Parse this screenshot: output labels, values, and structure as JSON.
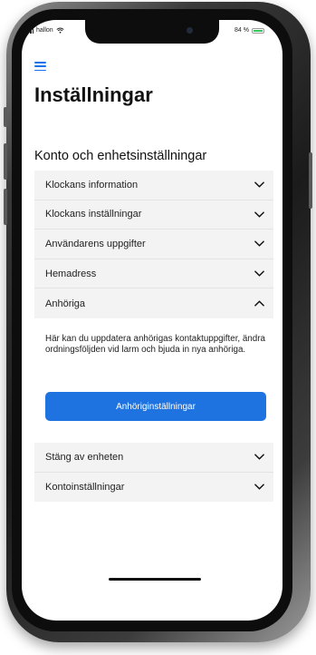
{
  "status_bar": {
    "carrier": "hallon",
    "battery_percent": "84 %",
    "battery_level": 0.84
  },
  "header": {
    "menu_icon": "hamburger-menu-icon",
    "title": "Inställningar"
  },
  "section": {
    "title": "Konto och enhetsinställningar",
    "items": [
      {
        "label": "Klockans information",
        "icon": "chevron-down-icon"
      },
      {
        "label": "Klockans inställningar",
        "icon": "chevron-down-icon"
      },
      {
        "label": "Användarens uppgifter",
        "icon": "chevron-down-icon"
      },
      {
        "label": "Hemadress",
        "icon": "chevron-down-icon"
      },
      {
        "label": "Anhöriga",
        "icon": "chevron-up-icon"
      }
    ],
    "expanded": {
      "text": "Här kan du uppdatera anhörigas kontaktuppgifter, ändra ordningsföljden vid larm och bjuda in nya anhöriga.",
      "button_label": "Anhöriginställningar"
    },
    "more_items": [
      {
        "label": "Stäng av enheten",
        "icon": "chevron-down-icon"
      },
      {
        "label": "Kontoinställningar",
        "icon": "chevron-down-icon"
      }
    ]
  },
  "colors": {
    "accent": "#1f73e0",
    "list_background": "#f3f3f3",
    "battery": "#34c759"
  }
}
